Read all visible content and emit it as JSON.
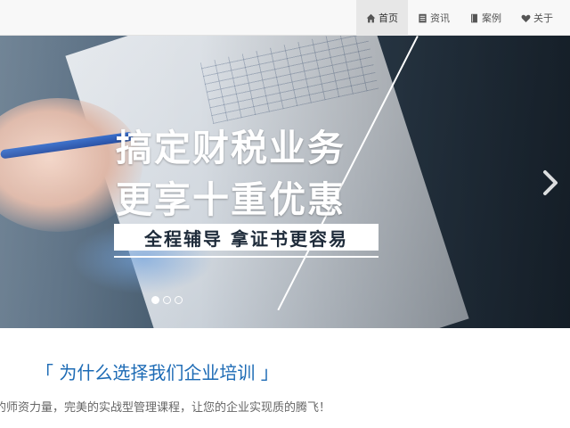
{
  "nav": {
    "items": [
      {
        "label": "首页",
        "icon": "home-icon",
        "active": true
      },
      {
        "label": "资讯",
        "icon": "news-icon",
        "active": false
      },
      {
        "label": "案例",
        "icon": "book-icon",
        "active": false
      },
      {
        "label": "关于",
        "icon": "heart-icon",
        "active": false
      }
    ]
  },
  "banner": {
    "headline_line1": "搞定财税业务",
    "headline_line2": "更享十重优惠",
    "subline": "全程辅导 拿证书更容易",
    "slide_count": 3,
    "active_slide": 1
  },
  "section": {
    "title": "「 为什么选择我们企业培训 」",
    "description": "的师资力量，完美的实战型管理课程，让您的企业实现质的腾飞！"
  },
  "colors": {
    "accent": "#1d6bb5",
    "nav_bg": "#f8f8f8",
    "nav_active_bg": "#e7e7e7"
  }
}
